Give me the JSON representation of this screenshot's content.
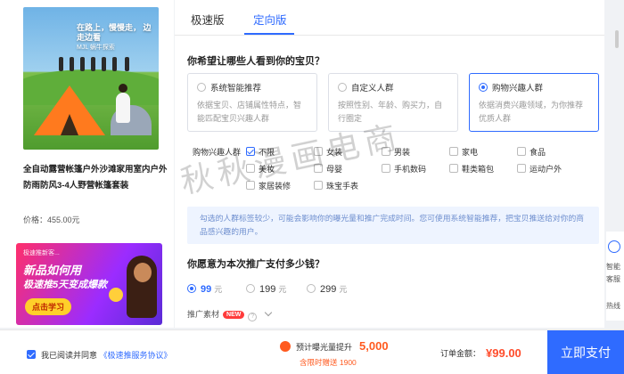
{
  "product": {
    "image_slogan": "在路上，慢慢走，  边走边看",
    "image_slogan_sub": "MJL 蜗牛探索",
    "title": "全自动露营帐篷户外沙滩家用室内户外防雨防风3-4人野营帐篷套装",
    "price": "价格：455.00元"
  },
  "banner": {
    "top": "极速推新客...",
    "line1": "新品如何用",
    "line2": "极速推5天变成爆款",
    "cta": "点击学习"
  },
  "tabs": [
    {
      "label": "极速版",
      "active": false
    },
    {
      "label": "定向版",
      "active": true
    }
  ],
  "audience": {
    "question": "你希望让哪些人看到你的宝贝？",
    "options": [
      {
        "title": "系统智能推荐",
        "desc": "依据宝贝、店铺属性特点，智能匹配宝贝兴趣人群",
        "selected": false
      },
      {
        "title": "自定义人群",
        "desc": "按照性别、年龄、购买力，自行圈定",
        "selected": false
      },
      {
        "title": "购物兴趣人群",
        "desc": "依据消费兴趣领域，为你推荐优质人群",
        "selected": true
      }
    ]
  },
  "interest": {
    "label": "购物兴趣人群",
    "items": [
      {
        "label": "不限",
        "checked": true
      },
      {
        "label": "女装",
        "checked": false
      },
      {
        "label": "男装",
        "checked": false
      },
      {
        "label": "家电",
        "checked": false
      },
      {
        "label": "食品",
        "checked": false
      },
      {
        "label": "美妆",
        "checked": false
      },
      {
        "label": "母婴",
        "checked": false
      },
      {
        "label": "手机数码",
        "checked": false
      },
      {
        "label": "鞋类箱包",
        "checked": false
      },
      {
        "label": "运动户外",
        "checked": false
      },
      {
        "label": "家居装修",
        "checked": false
      },
      {
        "label": "珠宝手表",
        "checked": false
      }
    ]
  },
  "notice": "勾选的人群标签较少，可能会影响你的曝光量和推广完成时间。您可使用系统智能推荐，把宝贝推送给对你的商品感兴趣的用户。",
  "budget": {
    "question": "你愿意为本次推广支付多少钱？",
    "unit": "元",
    "options": [
      {
        "value": "99",
        "selected": true
      },
      {
        "value": "199",
        "selected": false
      },
      {
        "value": "299",
        "selected": false
      }
    ]
  },
  "material": {
    "label": "推广素材",
    "badge": "NEW"
  },
  "watermark": "秋秋漫画电商",
  "side": {
    "line1": "智能",
    "line2": "客服",
    "line3": "热线"
  },
  "footer": {
    "agree_prefix": "我已阅读并同意",
    "agree_link": "《极速推服务协议》",
    "exposure_label": "预计曝光量提升",
    "exposure_value": "5,000",
    "gift": "含限时赠送 1900",
    "order_label": "订单金额：",
    "order_amount": "¥99.00",
    "pay_label": "立即支付"
  },
  "colors": {
    "accent": "#2f6bff",
    "highlight": "#ff5a1f",
    "price": "#ff4c2b"
  }
}
